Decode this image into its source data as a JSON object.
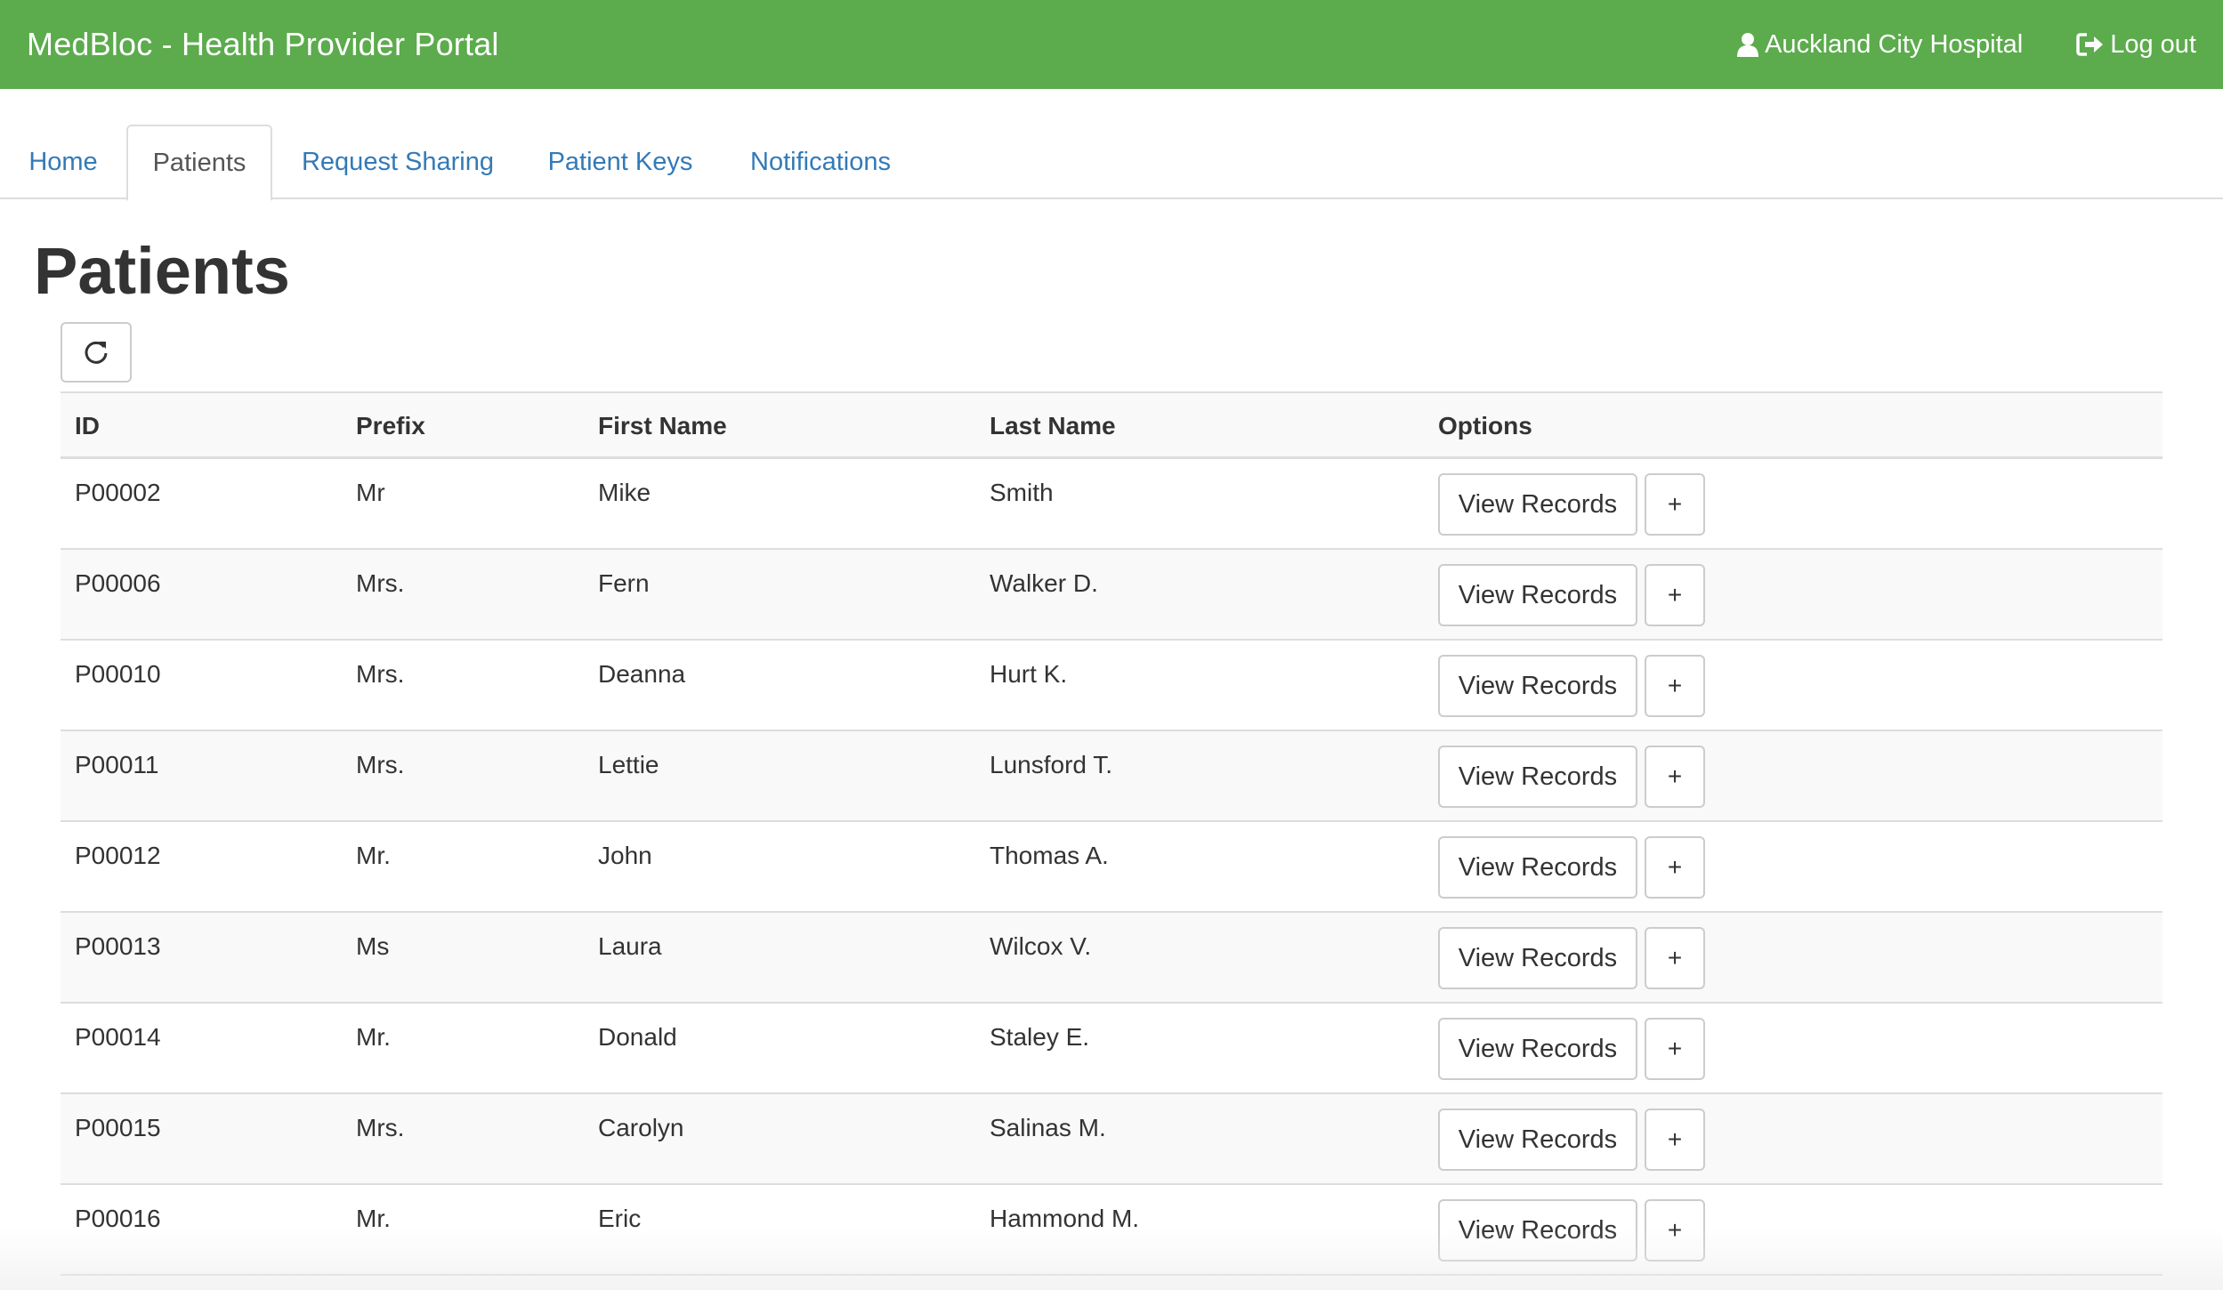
{
  "header": {
    "brand": "MedBloc - Health Provider Portal",
    "user_label": "Auckland City Hospital",
    "logout_label": "Log out",
    "color": "#5cab4d"
  },
  "tabs": [
    {
      "label": "Home",
      "active": false
    },
    {
      "label": "Patients",
      "active": true
    },
    {
      "label": "Request Sharing",
      "active": false
    },
    {
      "label": "Patient Keys",
      "active": false
    },
    {
      "label": "Notifications",
      "active": false
    }
  ],
  "page": {
    "title": "Patients",
    "refresh_icon": "refresh-icon"
  },
  "table": {
    "headers": [
      "ID",
      "Prefix",
      "First Name",
      "Last Name",
      "Options"
    ],
    "view_label": "View Records",
    "add_label": "+",
    "rows": [
      {
        "id": "P00002",
        "prefix": "Mr",
        "first": "Mike",
        "last": "Smith"
      },
      {
        "id": "P00006",
        "prefix": "Mrs.",
        "first": "Fern",
        "last": "Walker D."
      },
      {
        "id": "P00010",
        "prefix": "Mrs.",
        "first": "Deanna",
        "last": "Hurt K."
      },
      {
        "id": "P00011",
        "prefix": "Mrs.",
        "first": "Lettie",
        "last": "Lunsford T."
      },
      {
        "id": "P00012",
        "prefix": "Mr.",
        "first": "John",
        "last": "Thomas A."
      },
      {
        "id": "P00013",
        "prefix": "Ms",
        "first": "Laura",
        "last": "Wilcox V."
      },
      {
        "id": "P00014",
        "prefix": "Mr.",
        "first": "Donald",
        "last": "Staley E."
      },
      {
        "id": "P00015",
        "prefix": "Mrs.",
        "first": "Carolyn",
        "last": "Salinas M."
      },
      {
        "id": "P00016",
        "prefix": "Mr.",
        "first": "Eric",
        "last": "Hammond M."
      }
    ]
  }
}
